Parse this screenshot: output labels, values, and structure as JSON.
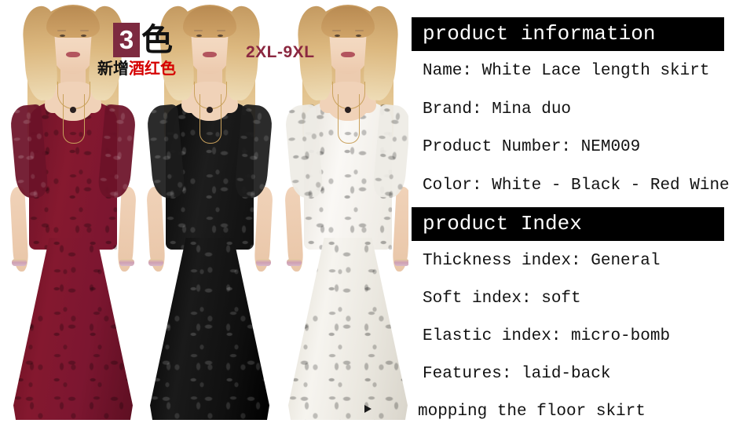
{
  "photo": {
    "count_badge": {
      "number": "3",
      "unit": "色",
      "badge_color": "#7d2a40"
    },
    "new_color_note": {
      "prefix": "新增",
      "highlight": "酒红色",
      "prefix_color": "#111111",
      "highlight_color": "#d50000"
    },
    "size_range": {
      "label": "2XL-9XL",
      "color": "#8b2840"
    },
    "models": [
      {
        "colorway": "Red Wine",
        "dress_color": "#7e1730",
        "dress_shadow": "#5d0f22",
        "sleeve_color": "#6c1228"
      },
      {
        "colorway": "Black",
        "dress_color": "#121212",
        "dress_shadow": "#000000",
        "sleeve_color": "#1c1c1c"
      },
      {
        "colorway": "White",
        "dress_color": "#f3f1ec",
        "dress_shadow": "#ddd9d1",
        "sleeve_color": "#eceae4"
      }
    ],
    "corner_mark": "play-triangle"
  },
  "info": {
    "sections": [
      {
        "heading": "product information",
        "lines": [
          "Name: White Lace length skirt",
          "Brand: Mina duo",
          "Product Number: NEM009",
          "Color: White - Black - Red Wine"
        ]
      },
      {
        "heading": "product Index",
        "lines": [
          "Thickness index: General",
          "Soft index: soft",
          "Elastic index: micro-bomb",
          "Features: laid-back",
          "mopping the floor skirt"
        ]
      }
    ]
  }
}
